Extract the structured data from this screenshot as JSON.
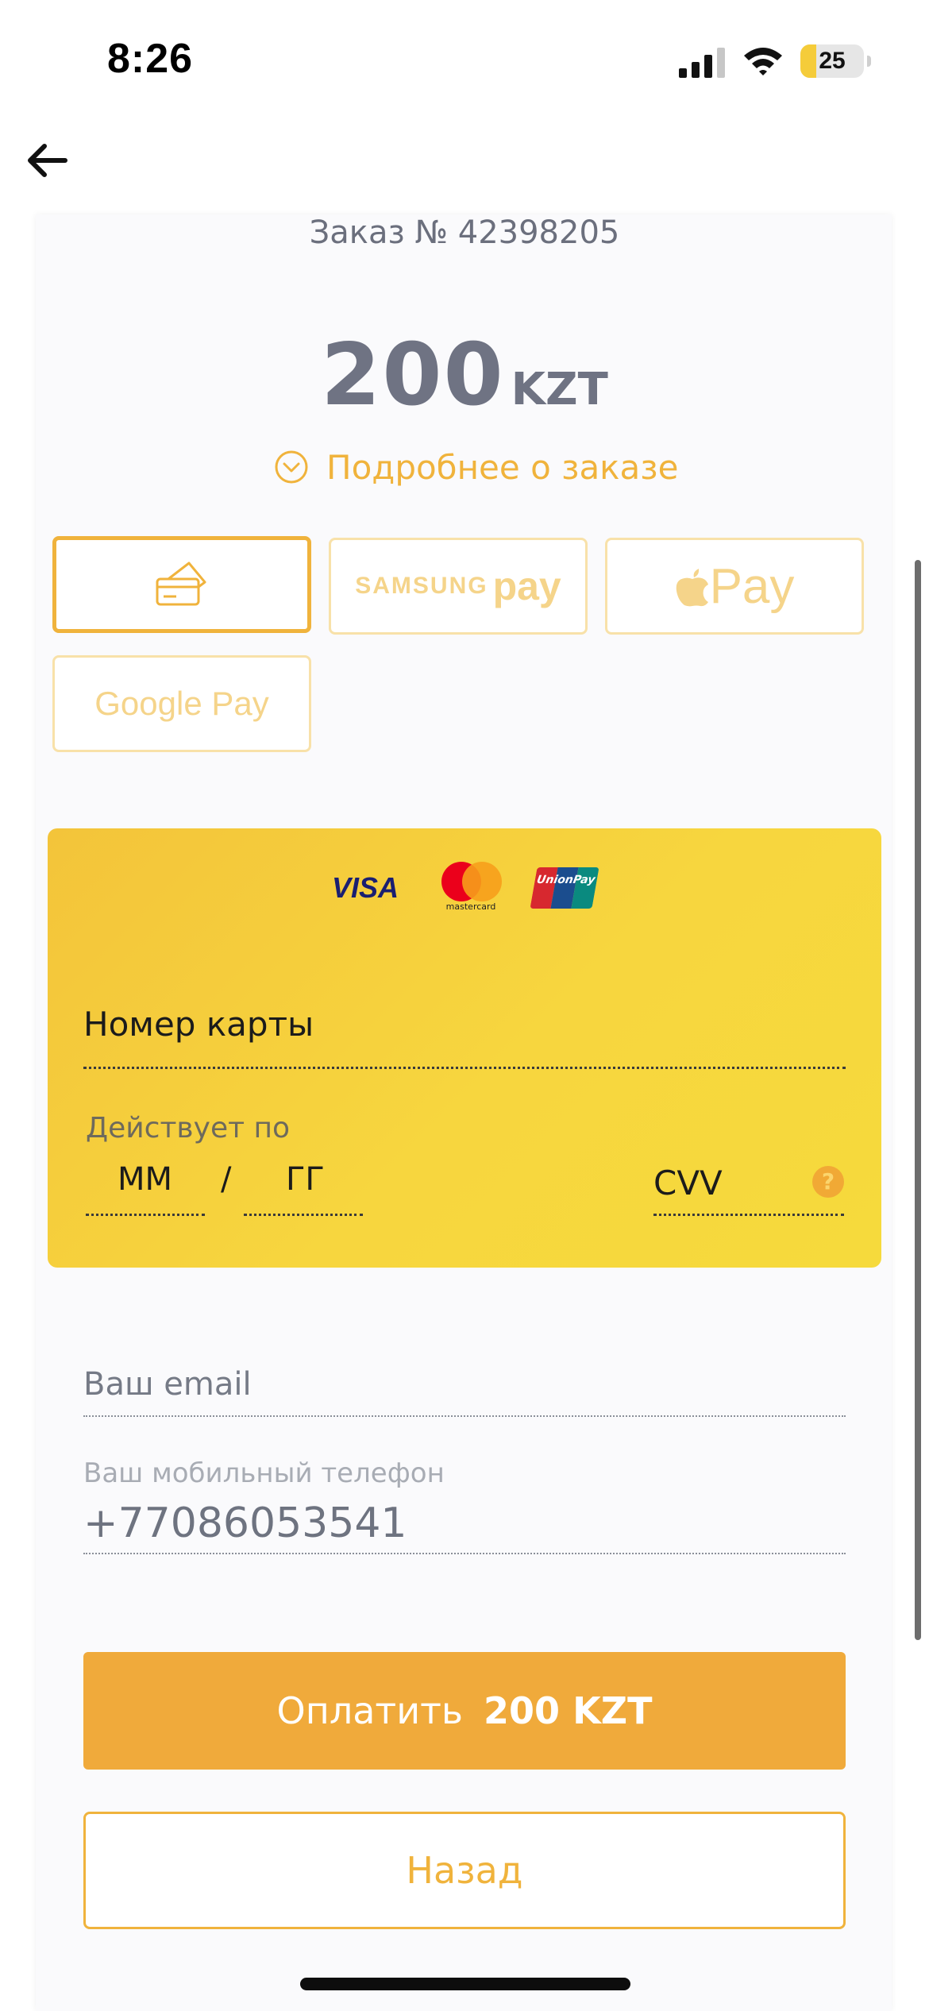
{
  "status_bar": {
    "time": "8:26",
    "battery_level": "25",
    "battery_fraction": 0.25,
    "signal_icon": "cellular-signal-icon",
    "wifi_icon": "wifi-icon"
  },
  "nav": {
    "back_icon": "arrow-left-icon"
  },
  "order": {
    "number_label": "Заказ № 42398205",
    "amount": "200",
    "currency": "KZT",
    "details_link": "Подробнее о заказе",
    "details_icon": "chevron-down-circle-icon"
  },
  "payment_methods": {
    "card_icon": "card-icon",
    "samsung_text": "SAMSUNG",
    "samsung_pay": "pay",
    "apple_pay": "Pay",
    "apple_icon": "apple-logo-icon",
    "google_pay": "Google Pay",
    "selected": "card"
  },
  "card_form": {
    "logos": {
      "visa": "VISA",
      "mastercard": "mastercard",
      "unionpay": "UnionPay"
    },
    "card_number_placeholder": "Номер карты",
    "valid_label": "Действует по",
    "month_placeholder": "ММ",
    "separator": "/",
    "year_placeholder": "ГГ",
    "cvv_placeholder": "CVV",
    "help_icon": "question-icon",
    "help_symbol": "?"
  },
  "contact": {
    "email_placeholder": "Ваш email",
    "phone_label": "Ваш мобильный телефон",
    "phone_value": "+77086053541"
  },
  "actions": {
    "pay_label": "Оплатить",
    "pay_amount": "200 KZT",
    "back_label": "Назад"
  },
  "colors": {
    "accent": "#f0b33c",
    "card_bg": "#f5cf3c",
    "pay_button": "#f0aa3b"
  }
}
